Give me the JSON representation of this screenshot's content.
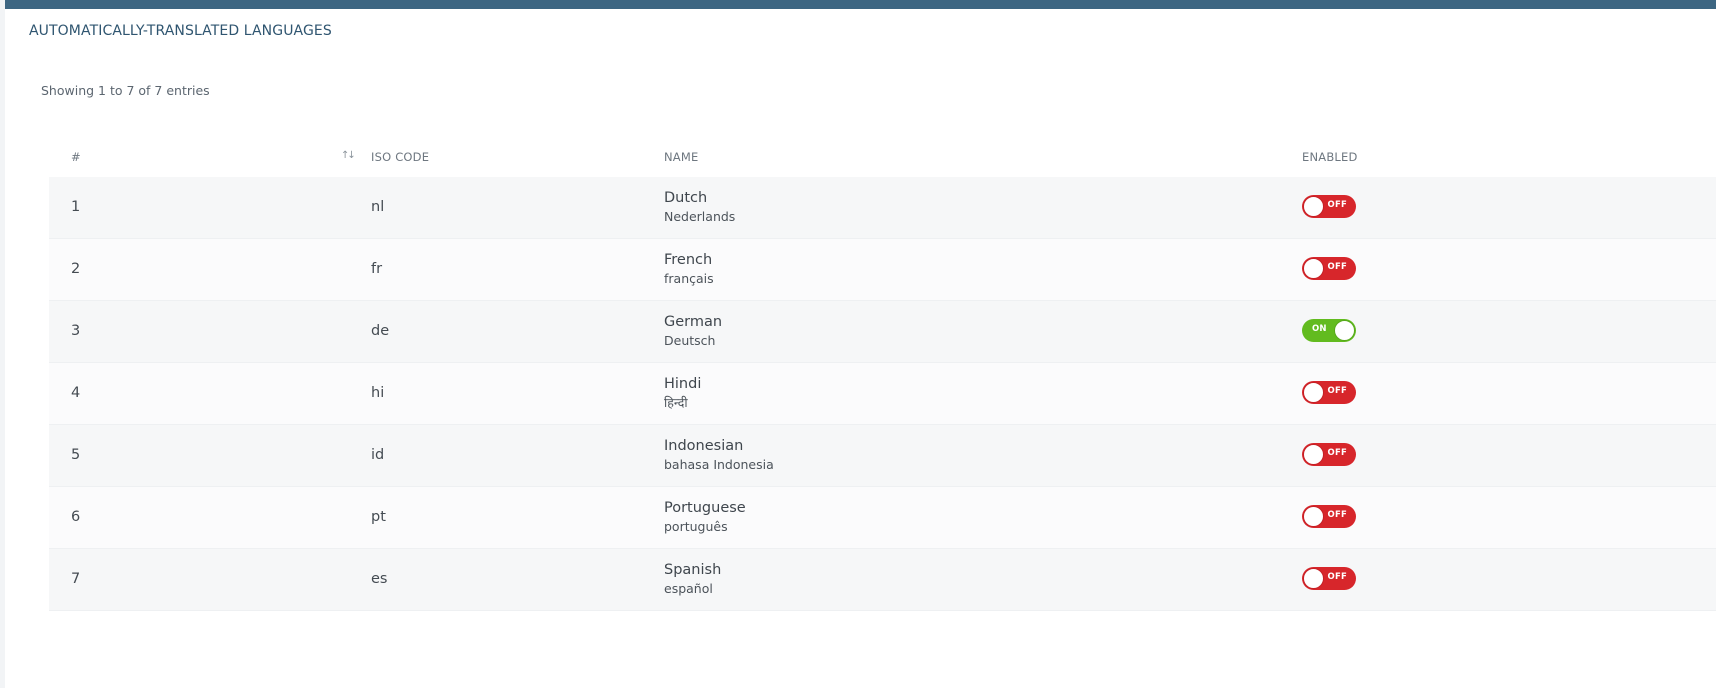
{
  "panel": {
    "title": "AUTOMATICALLY-TRANSLATED LANGUAGES",
    "accent_color": "#3d6682"
  },
  "table_info": "Showing 1 to 7 of 7 entries",
  "columns": {
    "num": "#",
    "sort_icon": "↑↓",
    "iso": "ISO CODE",
    "name": "NAME",
    "enabled": "ENABLED"
  },
  "colors": {
    "toggle_off": "#d7262b",
    "toggle_on": "#62bb1f"
  },
  "rows": [
    {
      "num": "1",
      "iso": "nl",
      "name": "Dutch",
      "native": "Nederlands",
      "enabled": false,
      "toggle_label": "OFF"
    },
    {
      "num": "2",
      "iso": "fr",
      "name": "French",
      "native": "français",
      "enabled": false,
      "toggle_label": "OFF"
    },
    {
      "num": "3",
      "iso": "de",
      "name": "German",
      "native": "Deutsch",
      "enabled": true,
      "toggle_label": "ON"
    },
    {
      "num": "4",
      "iso": "hi",
      "name": "Hindi",
      "native": "हिन्दी",
      "enabled": false,
      "toggle_label": "OFF"
    },
    {
      "num": "5",
      "iso": "id",
      "name": "Indonesian",
      "native": "bahasa Indonesia",
      "enabled": false,
      "toggle_label": "OFF"
    },
    {
      "num": "6",
      "iso": "pt",
      "name": "Portuguese",
      "native": "português",
      "enabled": false,
      "toggle_label": "OFF"
    },
    {
      "num": "7",
      "iso": "es",
      "name": "Spanish",
      "native": "español",
      "enabled": false,
      "toggle_label": "OFF"
    }
  ]
}
